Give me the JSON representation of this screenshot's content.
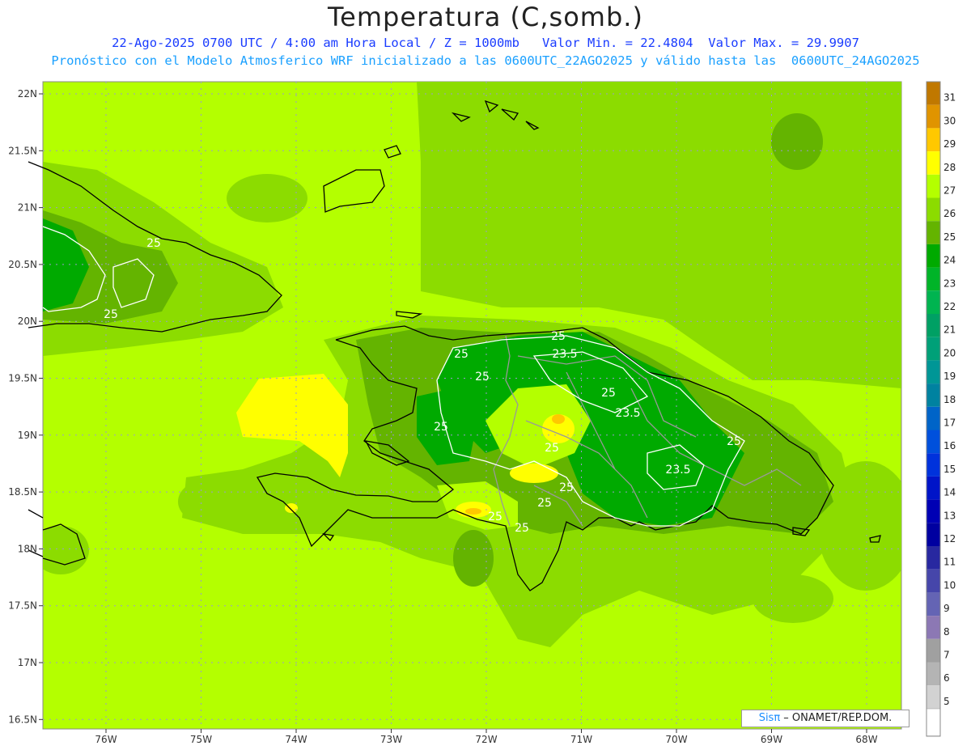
{
  "title": "Temperatura (C,somb.)",
  "subtitle1": "22-Ago-2025 0700 UTC / 4:00 am Hora Local / Z = 1000mb   Valor Min. = 22.4804  Valor Max. = 29.9907",
  "subtitle2": "Pronóstico con el Modelo Atmosferico WRF inicializado a las 0600UTC_22AGO2025 y válido hasta las  0600UTC_24AGO2025",
  "lat_labels": [
    "22N",
    "21.5N",
    "21N",
    "20.5N",
    "20N",
    "19.5N",
    "19N",
    "18.5N",
    "18N",
    "17.5N",
    "17N",
    "16.5N"
  ],
  "lon_labels": [
    "76W",
    "75W",
    "74W",
    "73W",
    "72W",
    "71W",
    "70W",
    "69W",
    "68W"
  ],
  "colorbar": {
    "labels": [
      "31",
      "30",
      "29",
      "28",
      "27",
      "26",
      "25",
      "24",
      "23",
      "22",
      "21",
      "20",
      "19",
      "18",
      "17",
      "16",
      "15",
      "14",
      "13",
      "12",
      "11",
      "10",
      "9",
      "8",
      "7",
      "6",
      "5"
    ],
    "colors": [
      "#c07800",
      "#e09400",
      "#ffc800",
      "#ffff00",
      "#b4ff00",
      "#8cdc00",
      "#64b400",
      "#00aa00",
      "#00b428",
      "#00b450",
      "#00a064",
      "#00a078",
      "#009696",
      "#0082a0",
      "#0064c8",
      "#0050dc",
      "#0032dc",
      "#0014c8",
      "#0000b4",
      "#0000a0",
      "#2828a0",
      "#4646aa",
      "#6464b4",
      "#8c78b4",
      "#a0a0a0",
      "#b4b4b4",
      "#d2d2d2"
    ],
    "bottom_color": "#ffffff"
  },
  "contour_labels": [
    "25",
    "25",
    "25",
    "25",
    "23.5",
    "25",
    "25",
    "23.5",
    "25",
    "25",
    "25",
    "25",
    "23.5",
    "25",
    "25",
    "25"
  ],
  "credit": {
    "sis": "Sisπ",
    "rest": " – ONAMET/REP.DOM."
  },
  "colors": {
    "sea": "#b4ff00",
    "land_mid": "#8cdc00",
    "land_warm_core": "#00aa00",
    "coast": "#000000",
    "border": "#999999"
  }
}
